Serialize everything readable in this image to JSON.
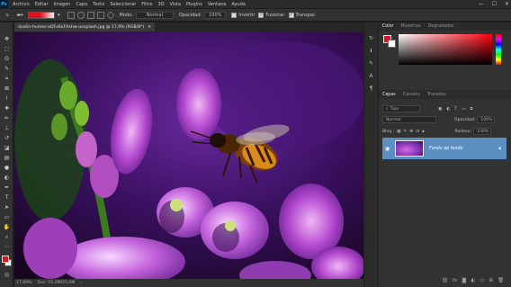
{
  "app": {
    "logo": "Ps"
  },
  "menubar": {
    "items": [
      "Archivo",
      "Editar",
      "Imagen",
      "Capa",
      "Texto",
      "Seleccionar",
      "Filtro",
      "3D",
      "Vista",
      "Plugins",
      "Ventana",
      "Ayuda"
    ],
    "window_controls": [
      "—",
      "☐",
      "✕"
    ]
  },
  "options": {
    "modo_label": "Modo:",
    "modo_value": "Normal",
    "opacidad_label": "Opacidad:",
    "opacidad_value": "100%",
    "invertir": "Invertir",
    "fusionar": "Fusionar",
    "transparencia": "Transpar."
  },
  "document": {
    "tab_title": "dustin-humes-aQFx6xFXxhw-unsplash.jpg @ 17,9% (RGB/8*)",
    "zoom": "17,89%",
    "doc_info": "Doc: 55,0M/55,0M"
  },
  "color_panel": {
    "tabs": [
      "Color",
      "Muestras",
      "Degradados"
    ],
    "fg_color": "#e0101c",
    "bg_color": "#ffffff"
  },
  "properties_tabs": [
    "Propiedades",
    "Ajustes",
    "Bibliotecas"
  ],
  "layers": {
    "tabs": [
      "Capas",
      "Canales",
      "Trazados"
    ],
    "filter_label": "Tipo",
    "blend_mode": "Normal",
    "opacity_label": "Opacidad:",
    "opacity_value": "100%",
    "lock_label": "Bloq.:",
    "fill_label": "Relleno:",
    "fill_value": "100%",
    "layer_name": "Fondo de fondo"
  },
  "tools": [
    "move-tool",
    "marquee-tool",
    "lasso-tool",
    "quick-select-tool",
    "crop-tool",
    "frame-tool",
    "eyedropper-tool",
    "healing-tool",
    "brush-tool",
    "stamp-tool",
    "history-brush-tool",
    "eraser-tool",
    "gradient-tool",
    "blur-tool",
    "dodge-tool",
    "pen-tool",
    "type-tool",
    "path-select-tool",
    "shape-tool",
    "hand-tool",
    "zoom-tool",
    "more-tools"
  ],
  "accent_colors": {
    "selected_layer": "#5b8fbf",
    "fg": "#e0101c"
  }
}
